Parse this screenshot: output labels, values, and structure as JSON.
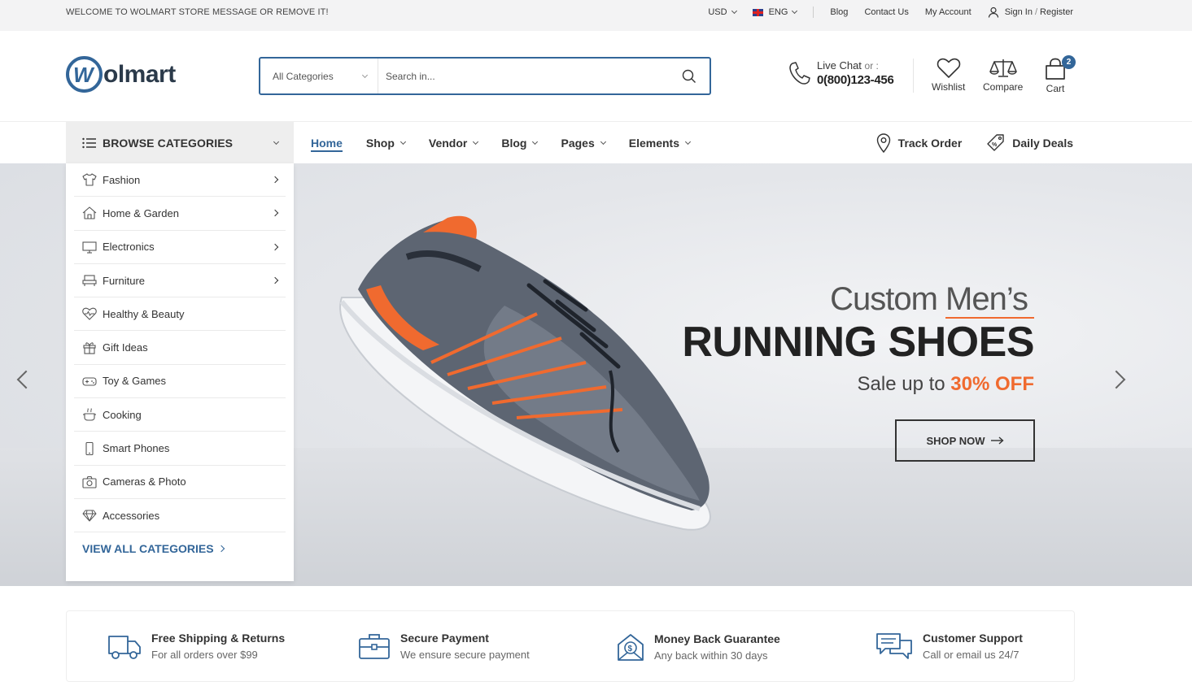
{
  "topbar": {
    "welcome": "WELCOME TO WOLMART STORE MESSAGE OR REMOVE IT!",
    "currency": "USD",
    "language": "ENG",
    "links": [
      "Blog",
      "Contact Us",
      "My Account"
    ],
    "sign_in": "Sign In",
    "sign_sep": "/",
    "register": "Register"
  },
  "header": {
    "logo_text": "olmart",
    "logo_letter": "W",
    "search": {
      "category": "All Categories",
      "placeholder": "Search in..."
    },
    "live_chat": "Live Chat",
    "or": "or :",
    "phone": "0(800)123-456",
    "wishlist": "Wishlist",
    "compare": "Compare",
    "cart": "Cart",
    "cart_count": "2"
  },
  "nav": {
    "browse": "BROWSE CATEGORIES",
    "items": [
      "Home",
      "Shop",
      "Vendor",
      "Blog",
      "Pages",
      "Elements"
    ],
    "track_order": "Track Order",
    "daily_deals": "Daily Deals"
  },
  "categories": {
    "items": [
      {
        "label": "Fashion",
        "icon": "tshirt-icon",
        "has_sub": true
      },
      {
        "label": "Home & Garden",
        "icon": "home-icon",
        "has_sub": true
      },
      {
        "label": "Electronics",
        "icon": "monitor-icon",
        "has_sub": true
      },
      {
        "label": "Furniture",
        "icon": "sofa-icon",
        "has_sub": true
      },
      {
        "label": "Healthy & Beauty",
        "icon": "heart-pulse-icon",
        "has_sub": false
      },
      {
        "label": "Gift Ideas",
        "icon": "gift-icon",
        "has_sub": false
      },
      {
        "label": "Toy & Games",
        "icon": "gamepad-icon",
        "has_sub": false
      },
      {
        "label": "Cooking",
        "icon": "pot-icon",
        "has_sub": false
      },
      {
        "label": "Smart Phones",
        "icon": "phone-icon",
        "has_sub": false
      },
      {
        "label": "Cameras & Photo",
        "icon": "camera-icon",
        "has_sub": false
      },
      {
        "label": "Accessories",
        "icon": "diamond-icon",
        "has_sub": false
      }
    ],
    "view_all": "VIEW ALL CATEGORIES"
  },
  "hero": {
    "subtitle_pre": "Custom",
    "subtitle_u": "Men’s",
    "title": "RUNNING SHOES",
    "sale_pre": "Sale up to",
    "sale_pct": "30% OFF",
    "cta": "SHOP NOW",
    "accent_color": "#f06a2f"
  },
  "features": [
    {
      "title": "Free Shipping & Returns",
      "sub": "For all orders over $99",
      "icon": "truck-icon"
    },
    {
      "title": "Secure Payment",
      "sub": "We ensure secure payment",
      "icon": "briefcase-icon"
    },
    {
      "title": "Money Back Guarantee",
      "sub": "Any back within 30 days",
      "icon": "money-back-icon"
    },
    {
      "title": "Customer Support",
      "sub": "Call or email us 24/7",
      "icon": "chat-icon"
    }
  ],
  "colors": {
    "primary": "#336699",
    "accent": "#f06a2f"
  }
}
